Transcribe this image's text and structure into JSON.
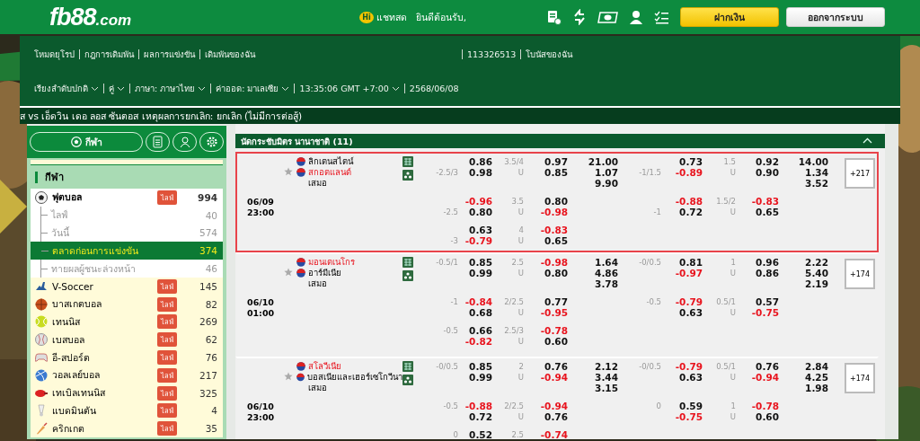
{
  "header": {
    "logo": {
      "brand": "fb88",
      "suffix": ".com"
    },
    "chat": {
      "badge": "Hi",
      "label": "แชทสด"
    },
    "welcome": "ยินดีต้อนรับ,",
    "deposit_button": "ฝากเงิน",
    "logout_button": "ออกจากระบบ"
  },
  "nav": {
    "links": [
      "โหมดยุโรป",
      "กฎการเดิมพัน",
      "ผลการแข่งขัน",
      "เดิมพันของฉัน",
      "113326513",
      "โบนัสของฉัน"
    ],
    "settings": [
      {
        "label": "เรียงลำดับปกติ",
        "dropdown": true
      },
      {
        "label": "คู่",
        "dropdown": true
      },
      {
        "label": "ภาษา: ภาษาไทย",
        "dropdown": true
      },
      {
        "label": "ค่าออด: มาเลเซีย",
        "dropdown": true
      },
      {
        "label": "13:35:06 GMT +7:00",
        "dropdown": true
      },
      {
        "label": "2568/06/08",
        "dropdown": false
      }
    ]
  },
  "ticker": "ส vs เอ็ดวิน เดอ ลอส ซันตอส เหตุผลการยกเลิก: ยกเลิก (ไม่มีการต่อสู้)",
  "sidebar": {
    "tab": "กีฬา",
    "section_title": "กีฬา",
    "sports": [
      {
        "name": "ฟุตบอล",
        "kind": "football",
        "live": "ไลฟ์",
        "count": "994",
        "expanded": true,
        "children": [
          {
            "name": "ไลฟ์",
            "count": "40",
            "selected": false
          },
          {
            "name": "วันนี้",
            "count": "574",
            "selected": false
          },
          {
            "name": "ตลาดก่อนการแข่งขัน",
            "count": "374",
            "selected": true
          },
          {
            "name": "ทายผลผู้ชนะล่วงหน้า",
            "count": "46",
            "selected": false
          }
        ]
      },
      {
        "name": "V-Soccer",
        "kind": "vsoccer",
        "live": "ไลฟ์",
        "count": "145",
        "expanded": false
      },
      {
        "name": "บาสเกตบอล",
        "kind": "basketball",
        "live": "ไลฟ์",
        "count": "82",
        "expanded": false
      },
      {
        "name": "เทนนิส",
        "kind": "tennis",
        "live": "ไลฟ์",
        "count": "269",
        "expanded": false
      },
      {
        "name": "เบสบอล",
        "kind": "baseball",
        "live": "ไลฟ์",
        "count": "62",
        "expanded": false
      },
      {
        "name": "อี-สปอร์ต",
        "kind": "esports",
        "live": "ไลฟ์",
        "count": "76",
        "expanded": false
      },
      {
        "name": "วอลเลย์บอล",
        "kind": "volleyball",
        "live": "ไลฟ์",
        "count": "217",
        "expanded": false
      },
      {
        "name": "เทเบิลเทนนิส",
        "kind": "tabletennis",
        "live": "ไลฟ์",
        "count": "325",
        "expanded": false
      },
      {
        "name": "แบดมินตัน",
        "kind": "badminton",
        "live": "ไลฟ์",
        "count": "4",
        "expanded": false
      },
      {
        "name": "คริกเกต",
        "kind": "cricket",
        "live": "ไลฟ์",
        "count": "35",
        "expanded": false
      }
    ]
  },
  "league": {
    "title": "นัดกระชับมิตร นานาชาติ (11)",
    "expanded": true
  },
  "matches": [
    {
      "date": "06/09",
      "time": "23:00",
      "highlighted": true,
      "teams": [
        {
          "name": "ลิกเตนสไตน์",
          "favored": false
        },
        {
          "name": "สกอตแลนด์",
          "favored": true
        }
      ],
      "draw": "เสมอ",
      "more": "+217",
      "x12": [
        "21.00",
        "1.07",
        "9.90"
      ],
      "ht_x12": [
        "14.00",
        "1.34",
        "3.52"
      ],
      "lines": [
        {
          "hdp": {
            "line": "-2.5/3",
            "away_gives": true,
            "home": "0.86",
            "away": "0.98"
          },
          "ou": {
            "line": "3.5/4",
            "side": "U",
            "over": "0.97",
            "under": "0.85"
          },
          "ht_hdp": {
            "line": "-1/1.5",
            "away_gives": true,
            "home": "0.73",
            "away": "-0.89"
          },
          "ht_ou": {
            "line": "1.5",
            "side": "U",
            "over": "0.92",
            "under": "0.90"
          }
        },
        {
          "hdp": {
            "line": "-2.5",
            "away_gives": true,
            "home": "-0.96",
            "away": "0.80"
          },
          "ou": {
            "line": "3.5",
            "side": "U",
            "over": "0.80",
            "under": "-0.98"
          },
          "ht_hdp": {
            "line": "-1",
            "away_gives": true,
            "home": "-0.88",
            "away": "0.72"
          },
          "ht_ou": {
            "line": "1.5/2",
            "side": "U",
            "over": "-0.83",
            "under": "0.65"
          }
        },
        {
          "hdp": {
            "line": "-3",
            "away_gives": true,
            "home": "0.63",
            "away": "-0.79"
          },
          "ou": {
            "line": "4",
            "side": "U",
            "over": "-0.83",
            "under": "0.65"
          }
        }
      ]
    },
    {
      "date": "06/10",
      "time": "01:00",
      "highlighted": false,
      "teams": [
        {
          "name": "มอนเตเนโกร",
          "favored": true
        },
        {
          "name": "อาร์มีเนีย",
          "favored": false
        }
      ],
      "draw": "เสมอ",
      "more": "+174",
      "x12": [
        "1.64",
        "4.86",
        "3.78"
      ],
      "ht_x12": [
        "2.22",
        "5.40",
        "2.19"
      ],
      "lines": [
        {
          "hdp": {
            "line": "-0.5/1",
            "away_gives": false,
            "home": "0.85",
            "away": "0.99"
          },
          "ou": {
            "line": "2.5",
            "side": "U",
            "over": "-0.98",
            "under": "0.80"
          },
          "ht_hdp": {
            "line": "-0/0.5",
            "away_gives": false,
            "home": "0.81",
            "away": "-0.97"
          },
          "ht_ou": {
            "line": "1",
            "side": "U",
            "over": "0.96",
            "under": "0.86"
          }
        },
        {
          "hdp": {
            "line": "-1",
            "away_gives": false,
            "home": "-0.84",
            "away": "0.68"
          },
          "ou": {
            "line": "2/2.5",
            "side": "U",
            "over": "0.77",
            "under": "-0.95"
          },
          "ht_hdp": {
            "line": "-0.5",
            "away_gives": false,
            "home": "-0.79",
            "away": "0.63"
          },
          "ht_ou": {
            "line": "0.5/1",
            "side": "U",
            "over": "0.57",
            "under": "-0.75"
          }
        },
        {
          "hdp": {
            "line": "-0.5",
            "away_gives": false,
            "home": "0.66",
            "away": "-0.82"
          },
          "ou": {
            "line": "2.5/3",
            "side": "U",
            "over": "-0.78",
            "under": "0.60"
          }
        }
      ]
    },
    {
      "date": "06/10",
      "time": "23:00",
      "highlighted": false,
      "teams": [
        {
          "name": "สโลวีเนีย",
          "favored": true
        },
        {
          "name": "บอสเนียและเฮอร์เซโกวีนา",
          "favored": false
        }
      ],
      "draw": "เสมอ",
      "more": "+174",
      "x12": [
        "2.12",
        "3.44",
        "3.15"
      ],
      "ht_x12": [
        "2.84",
        "4.25",
        "1.98"
      ],
      "lines": [
        {
          "hdp": {
            "line": "-0/0.5",
            "away_gives": false,
            "home": "0.85",
            "away": "0.99"
          },
          "ou": {
            "line": "2",
            "side": "U",
            "over": "0.76",
            "under": "-0.94"
          },
          "ht_hdp": {
            "line": "-0/0.5",
            "away_gives": false,
            "home": "-0.79",
            "away": "0.63"
          },
          "ht_ou": {
            "line": "0.5/1",
            "side": "U",
            "over": "0.76",
            "under": "-0.94"
          }
        },
        {
          "hdp": {
            "line": "-0.5",
            "away_gives": false,
            "home": "-0.88",
            "away": "0.72"
          },
          "ou": {
            "line": "2/2.5",
            "side": "U",
            "over": "-0.94",
            "under": "0.76"
          },
          "ht_hdp": {
            "line": "0",
            "away_gives": false,
            "home": "0.59",
            "away": "-0.75"
          },
          "ht_ou": {
            "line": "1",
            "side": "U",
            "over": "-0.78",
            "under": "0.60"
          }
        },
        {
          "hdp": {
            "line": "0",
            "away_gives": false,
            "home": "0.52"
          },
          "ou": {
            "line": "2.5",
            "over": "-0.74"
          }
        }
      ]
    }
  ]
}
